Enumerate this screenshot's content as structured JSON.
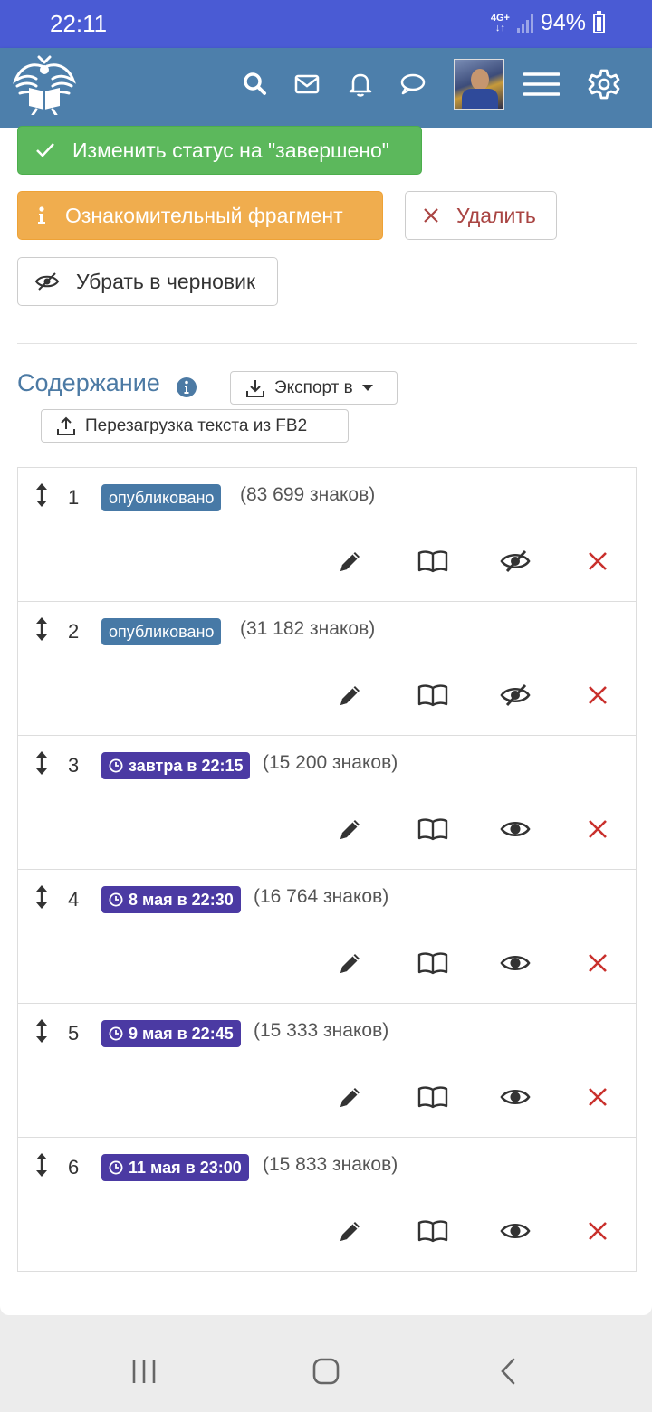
{
  "statusbar": {
    "time": "22:11",
    "network": "4G+",
    "battery": "94%"
  },
  "navbar": {
    "icons": [
      "logo-icon",
      "search-icon",
      "mail-icon",
      "bell-icon",
      "chat-icon",
      "avatar",
      "menu-icon",
      "gear-icon"
    ]
  },
  "actions": {
    "complete_label": "Изменить статус на \"завершено\"",
    "fragment_label": "Ознакомительный фрагмент",
    "delete_label": "Удалить",
    "draft_label": "Убрать в черновик"
  },
  "contents": {
    "title": "Содержание",
    "export_label": "Экспорт в",
    "reload_label": "Перезагрузка текста из FB2"
  },
  "chapters": [
    {
      "num": "1",
      "status": "опубликовано",
      "type": "published",
      "chars": "(83 699 знаков)",
      "visibility": "hidden-icon"
    },
    {
      "num": "2",
      "status": "опубликовано",
      "type": "published",
      "chars": "(31 182 знаков)",
      "visibility": "hidden-icon"
    },
    {
      "num": "3",
      "status": "завтра в 22:15",
      "type": "scheduled",
      "chars": "(15 200 знаков)",
      "visibility": "eye-icon"
    },
    {
      "num": "4",
      "status": "8 мая в 22:30",
      "type": "scheduled",
      "chars": "(16 764 знаков)",
      "visibility": "eye-icon"
    },
    {
      "num": "5",
      "status": "9 мая в 22:45",
      "type": "scheduled",
      "chars": "(15 333 знаков)",
      "visibility": "eye-icon"
    },
    {
      "num": "6",
      "status": "11 мая в 23:00",
      "type": "scheduled",
      "chars": "(15 833 знаков)",
      "visibility": "eye-icon"
    }
  ],
  "colors": {
    "statusbar": "#4a5bd4",
    "navbar": "#4d7fab",
    "success": "#5cb85c",
    "warning": "#f0ad4e",
    "danger": "#a94442",
    "published_badge": "#4779a6",
    "scheduled_badge": "#4b3aa3",
    "delete_x": "#c9302c"
  }
}
